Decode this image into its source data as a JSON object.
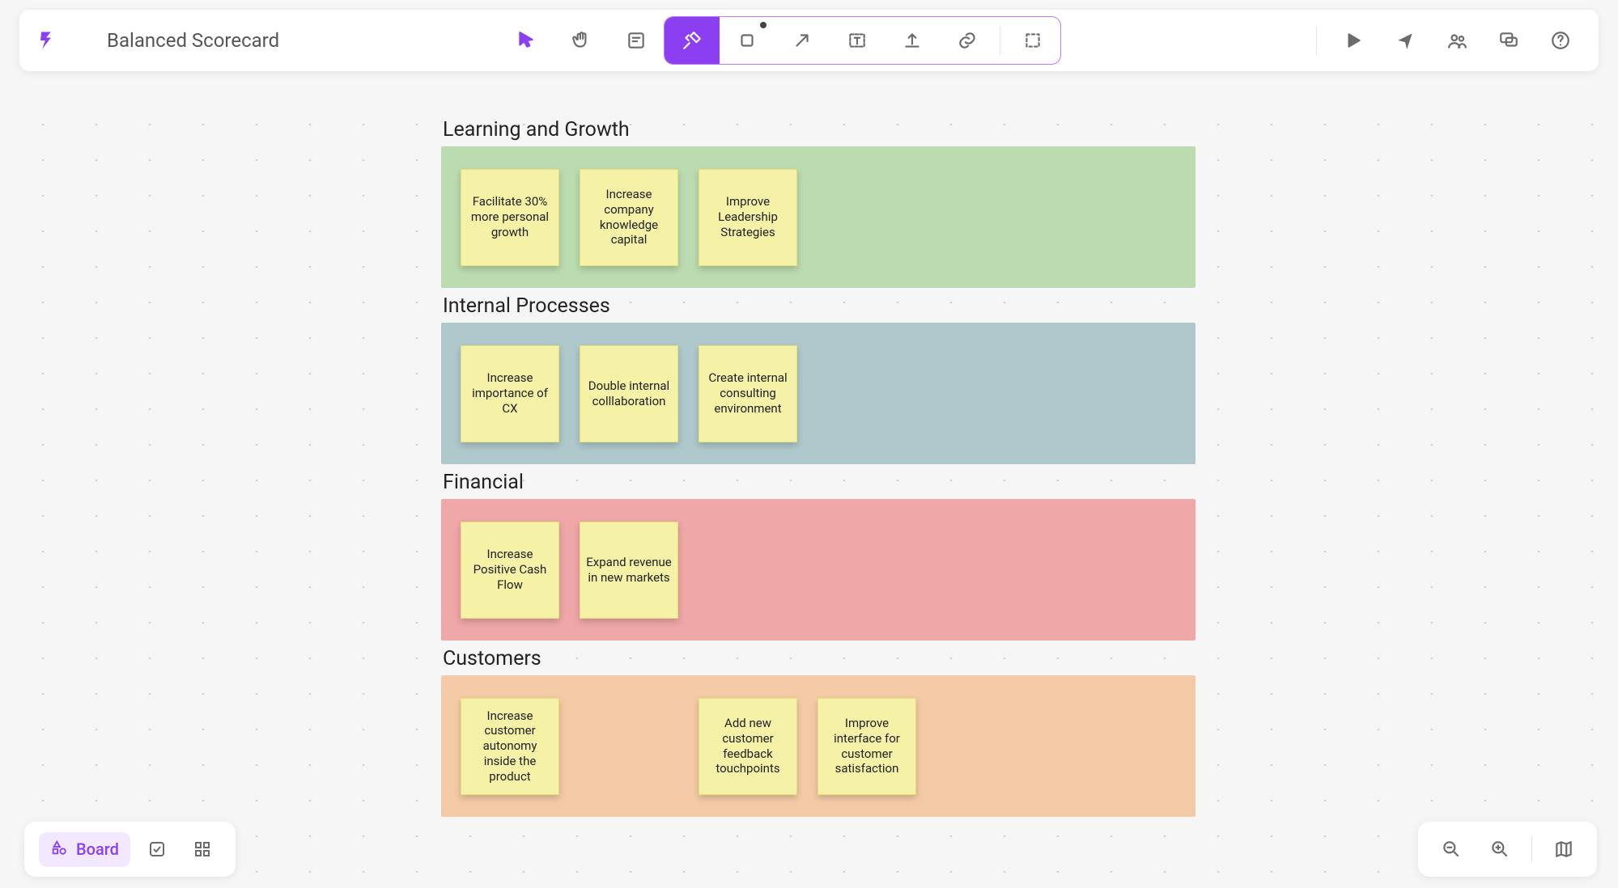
{
  "document": {
    "title": "Balanced Scorecard"
  },
  "footer": {
    "board_label": "Board"
  },
  "sections": [
    {
      "title": "Learning and Growth",
      "color": "green",
      "notes": [
        "Facilitate 30% more personal growth",
        "Increase company knowledge capital",
        "Improve Leadership Strategies"
      ],
      "slots": [
        0,
        1,
        2
      ]
    },
    {
      "title": "Internal Processes",
      "color": "blue",
      "notes": [
        "Increase importance of CX",
        "Double internal colllaboration",
        "Create internal consulting environment"
      ],
      "slots": [
        0,
        1,
        2
      ]
    },
    {
      "title": "Financial",
      "color": "red",
      "notes": [
        "Increase Positive Cash Flow",
        "Expand revenue in new markets"
      ],
      "slots": [
        0,
        1
      ]
    },
    {
      "title": "Customers",
      "color": "orange",
      "notes": [
        "Increase customer autonomy inside the product",
        "Add new customer feedback touchpoints",
        "Improve interface for customer satisfaction"
      ],
      "slots": [
        0,
        2,
        3
      ]
    }
  ]
}
